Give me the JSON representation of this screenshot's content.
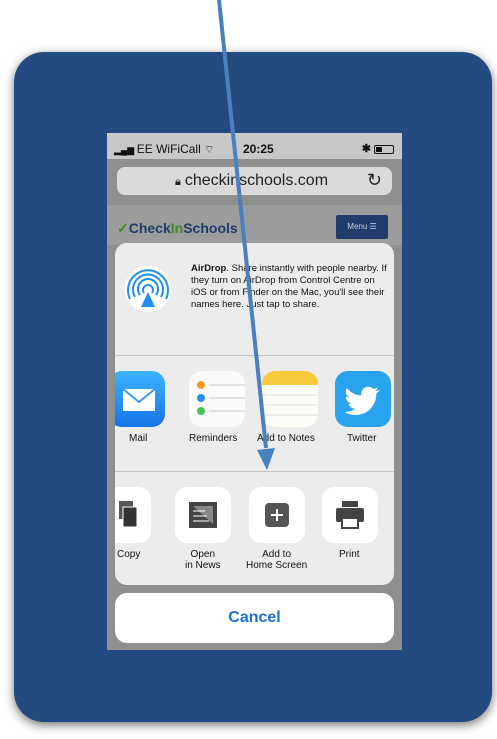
{
  "status_bar": {
    "carrier": "EE WiFiCall",
    "time": "20:25",
    "bluetooth": "∦",
    "battery_icon": "battery-icon"
  },
  "browser": {
    "url": "checkinschools.com",
    "lock_icon": "lock-icon",
    "reload_icon": "reload-icon"
  },
  "site": {
    "logo_check": "✓",
    "logo_prefix": "Check",
    "logo_accent": "In",
    "logo_suffix": "Schools",
    "menu_label": "Menu ☰"
  },
  "share_sheet": {
    "airdrop_title": "AirDrop",
    "airdrop_text": ". Share instantly with people nearby. If they turn on AirDrop from Control Centre on iOS or from Finder on the Mac, you'll see their names here. Just tap to share.",
    "apps": [
      {
        "label": "Mail",
        "icon": "mail-icon"
      },
      {
        "label": "Reminders",
        "icon": "reminders-icon"
      },
      {
        "label": "Add to Notes",
        "icon": "notes-icon"
      },
      {
        "label": "Twitter",
        "icon": "twitter-icon"
      }
    ],
    "actions": [
      {
        "label": "Copy",
        "icon": "copy-icon"
      },
      {
        "label": "Open\nin News",
        "line1": "Open",
        "line2": "in News",
        "icon": "news-icon"
      },
      {
        "label": "Add to\nHome Screen",
        "line1": "Add to",
        "line2": "Home Screen",
        "icon": "add-home-screen-icon"
      },
      {
        "label": "Print",
        "icon": "print-icon"
      }
    ],
    "cancel_label": "Cancel"
  },
  "colors": {
    "frame": "#234b7f",
    "cancel_text": "#1c6fd8",
    "arrow": "#4a7fc0"
  }
}
